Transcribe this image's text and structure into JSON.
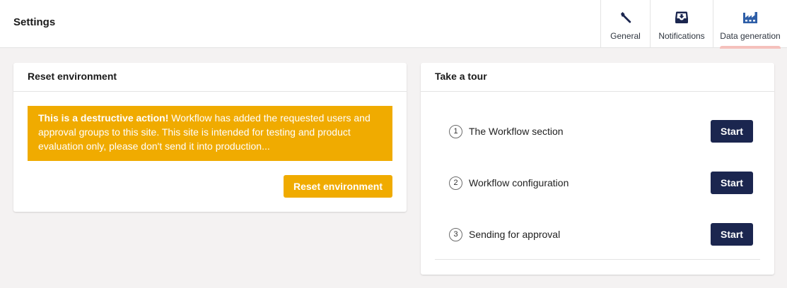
{
  "header": {
    "title": "Settings",
    "tabs": [
      {
        "label": "General",
        "icon": "wrench-icon"
      },
      {
        "label": "Notifications",
        "icon": "inbox-icon"
      },
      {
        "label": "Data generation",
        "icon": "factory-icon",
        "active": true
      }
    ]
  },
  "reset_card": {
    "title": "Reset environment",
    "warning_bold": "This is a destructive action!",
    "warning_text": " Workflow has added the requested users and approval groups to this site. This site is intended for testing and product evaluation only, please don't send it into production...",
    "button_label": "Reset environment"
  },
  "tour_card": {
    "title": "Take a tour",
    "items": [
      {
        "number": "1",
        "label": "The Workflow section",
        "button_label": "Start"
      },
      {
        "number": "2",
        "label": "Workflow configuration",
        "button_label": "Start"
      },
      {
        "number": "3",
        "label": "Sending for approval",
        "button_label": "Start"
      }
    ]
  },
  "colors": {
    "accent_navy": "#1b264f",
    "warning": "#f0ab00",
    "active_tab_indicator": "#f5c1bc",
    "background": "#f4f2f2"
  }
}
